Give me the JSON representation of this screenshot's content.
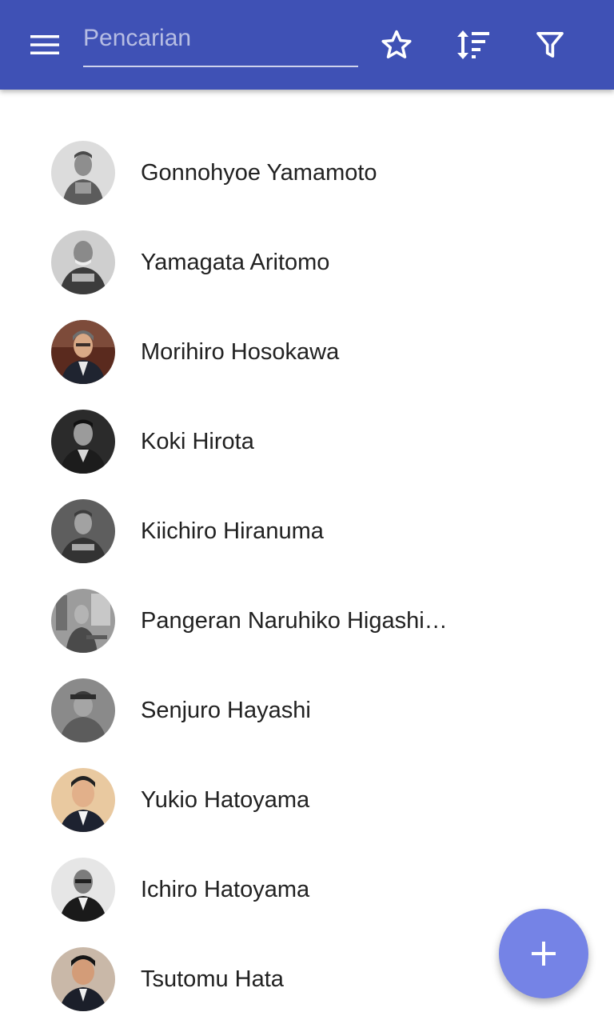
{
  "toolbar": {
    "menu_icon": "hamburger-menu-icon",
    "search": {
      "value": "",
      "placeholder": "Pencarian"
    },
    "favorite_icon": "star-outline-icon",
    "sort_icon": "sort-icon",
    "filter_icon": "filter-icon",
    "colors": {
      "primary": "#3f51b5",
      "fab": "#7583e6"
    }
  },
  "people": [
    {
      "name": "Gonnohyoe Yamamoto",
      "avatar_icon": "portrait-photo"
    },
    {
      "name": "Yamagata Aritomo",
      "avatar_icon": "portrait-photo"
    },
    {
      "name": "Morihiro Hosokawa",
      "avatar_icon": "portrait-photo"
    },
    {
      "name": "Koki Hirota",
      "avatar_icon": "portrait-photo"
    },
    {
      "name": "Kiichiro Hiranuma",
      "avatar_icon": "portrait-photo"
    },
    {
      "name": "Pangeran Naruhiko Higashi…",
      "avatar_icon": "portrait-photo"
    },
    {
      "name": "Senjuro Hayashi",
      "avatar_icon": "portrait-photo"
    },
    {
      "name": "Yukio Hatoyama",
      "avatar_icon": "portrait-photo"
    },
    {
      "name": "Ichiro Hatoyama",
      "avatar_icon": "portrait-photo"
    },
    {
      "name": "Tsutomu Hata",
      "avatar_icon": "portrait-photo"
    }
  ],
  "fab": {
    "icon": "plus-icon"
  }
}
